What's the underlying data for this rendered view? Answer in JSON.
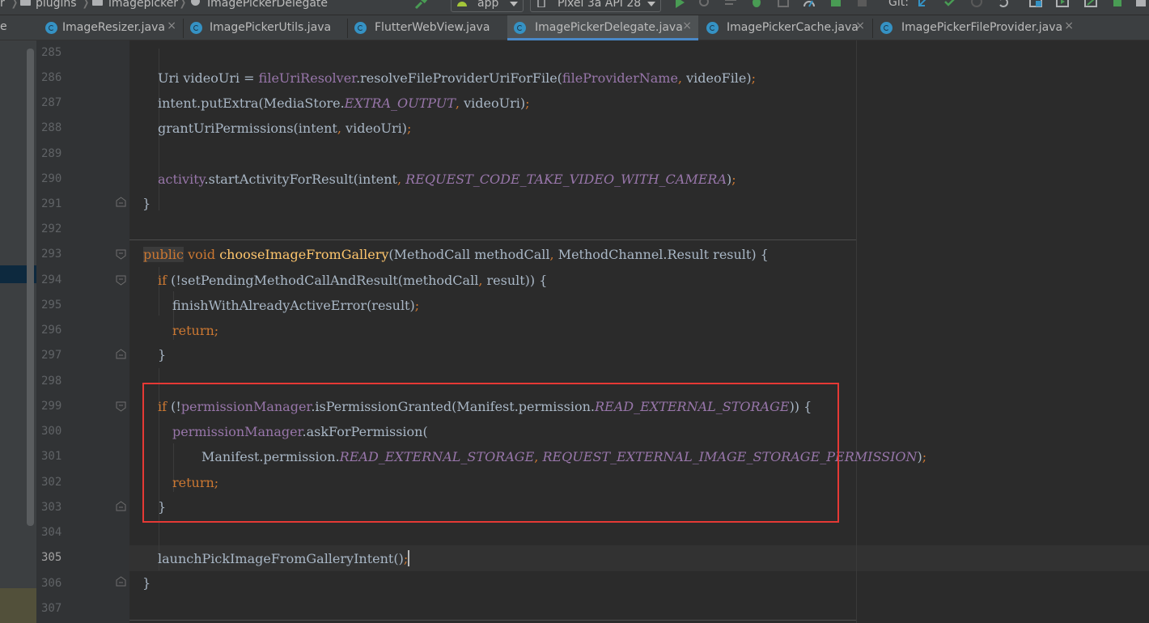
{
  "breadcrumb": {
    "items": [
      "r",
      "plugins",
      "imagepicker",
      "ImagePickerDelegate"
    ]
  },
  "toolbar": {
    "run_config": "app",
    "device": "Pixel 3a API 28",
    "git_label": "Git:",
    "icons": [
      "hammer-icon",
      "android-icon",
      "run-icon",
      "rerun-icon",
      "debug-icon",
      "profile-icon",
      "attach-icon",
      "apply-changes-icon",
      "stop-icon",
      "git-update-icon",
      "git-commit-icon",
      "git-history-icon",
      "git-rollback-icon",
      "sdk-manager-icon",
      "avd-manager-icon",
      "android-device-icon"
    ]
  },
  "tabs": [
    {
      "label": "ImageResizer.java",
      "active": false
    },
    {
      "label": "ImagePickerUtils.java",
      "active": false
    },
    {
      "label": "FlutterWebView.java",
      "active": false
    },
    {
      "label": "ImagePickerDelegate.java",
      "active": true
    },
    {
      "label": "ImagePickerCache.java",
      "active": false
    },
    {
      "label": "ImagePickerFileProvider.java",
      "active": false
    }
  ],
  "tab_close_glyph": "×",
  "tabs_overflow_glyph": "e",
  "editor": {
    "current_line": "305",
    "lines": [
      {
        "n": "285"
      },
      {
        "n": "286",
        "parts": {
          "a": "Uri videoUri = ",
          "b": "fileUriResolver",
          "c": ".resolveFileProviderUriForFile(",
          "d": "fileProviderName",
          "e": ",",
          "f": " videoFile)",
          "g": ";"
        }
      },
      {
        "n": "287",
        "parts": {
          "a": "intent.putExtra(MediaStore.",
          "b": "EXTRA_OUTPUT",
          "c": ",",
          "d": " videoUri)",
          "e": ";"
        }
      },
      {
        "n": "288",
        "parts": {
          "a": "grantUriPermissions(intent",
          "b": ",",
          "c": " videoUri)",
          "d": ";"
        }
      },
      {
        "n": "289"
      },
      {
        "n": "290",
        "parts": {
          "a": "activity",
          "b": ".startActivityForResult(intent",
          "c": ",",
          "d": " ",
          "e": "REQUEST_CODE_TAKE_VIDEO_WITH_CAMERA",
          "f": ")",
          "g": ";"
        }
      },
      {
        "n": "291",
        "parts": {
          "a": "}"
        }
      },
      {
        "n": "292"
      },
      {
        "n": "293",
        "parts": {
          "a": "public",
          "b": " ",
          "c": "void",
          "d": " ",
          "e": "chooseImageFromGallery",
          "f": "(MethodCall methodCall",
          "g": ",",
          "h": " MethodChannel.Result result) {"
        }
      },
      {
        "n": "294",
        "parts": {
          "a": "if",
          "b": " (!setPendingMethodCallAndResult(methodCall",
          "c": ",",
          "d": " result)) {"
        }
      },
      {
        "n": "295",
        "parts": {
          "a": "finishWithAlreadyActiveError(result)",
          "b": ";"
        }
      },
      {
        "n": "296",
        "parts": {
          "a": "return;"
        }
      },
      {
        "n": "297",
        "parts": {
          "a": "}"
        }
      },
      {
        "n": "298"
      },
      {
        "n": "299",
        "parts": {
          "a": "if",
          "b": " (!",
          "c": "permissionManager",
          "d": ".isPermissionGranted(Manifest.permission.",
          "e": "READ_EXTERNAL_STORAGE",
          "f": ")) {"
        }
      },
      {
        "n": "300",
        "parts": {
          "a": "permissionManager",
          "b": ".askForPermission("
        }
      },
      {
        "n": "301",
        "parts": {
          "a": "Manifest.permission.",
          "b": "READ_EXTERNAL_STORAGE",
          "c": ",",
          "d": " ",
          "e": "REQUEST_EXTERNAL_IMAGE_STORAGE_PERMISSION",
          "f": ")",
          "g": ";"
        }
      },
      {
        "n": "302",
        "parts": {
          "a": "return;"
        }
      },
      {
        "n": "303",
        "parts": {
          "a": "}"
        }
      },
      {
        "n": "304"
      },
      {
        "n": "305",
        "parts": {
          "a": "launchPickImageFromGalleryIntent()",
          "b": ";"
        }
      },
      {
        "n": "306",
        "parts": {
          "a": "}"
        }
      },
      {
        "n": "307"
      }
    ]
  },
  "annotation": {
    "color": "#e53935"
  },
  "colors": {
    "keyword": "#cc7832",
    "field": "#9876aa",
    "method_decl": "#ffc66d",
    "text": "#a9b7c6",
    "line_number": "#606366",
    "tab_underline": "#4a88c7"
  }
}
